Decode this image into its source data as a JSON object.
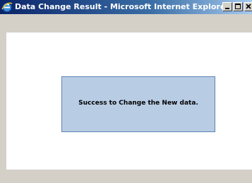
{
  "window": {
    "title": "Data Change Result - Microsoft Internet Explorer",
    "app_icon": "internet-explorer-icon",
    "controls": {
      "minimize_icon": "minimize-icon",
      "maximize_icon": "maximize-icon",
      "close_icon": "close-icon"
    }
  },
  "content": {
    "message": "Success to Change the New data."
  },
  "colors": {
    "titlebar_start": "#0a246a",
    "titlebar_end": "#a6caf0",
    "message_box_fill": "#b8cce4",
    "message_box_border": "#5c85b5",
    "frame": "#d4d0c8"
  }
}
